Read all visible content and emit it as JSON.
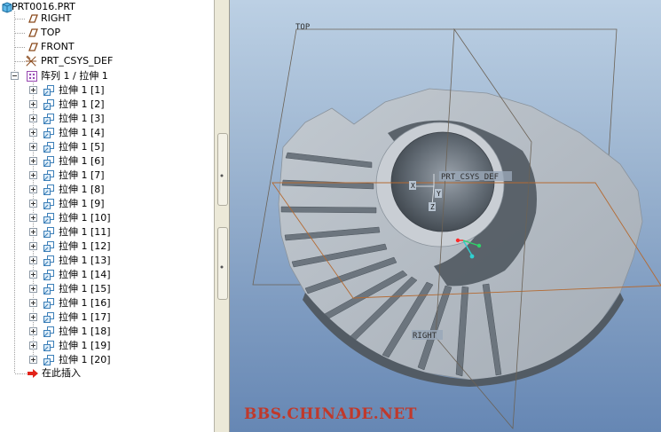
{
  "tree": {
    "root": "PRT0016.PRT",
    "datums": [
      {
        "label": "RIGHT",
        "icon": "datum-plane-icon"
      },
      {
        "label": "TOP",
        "icon": "datum-plane-icon"
      },
      {
        "label": "FRONT",
        "icon": "datum-plane-icon"
      },
      {
        "label": "PRT_CSYS_DEF",
        "icon": "coordinate-system-icon"
      }
    ],
    "pattern": "阵列 1 / 拉伸 1",
    "extrudes": [
      "拉伸 1 [1]",
      "拉伸 1 [2]",
      "拉伸 1 [3]",
      "拉伸 1 [4]",
      "拉伸 1 [5]",
      "拉伸 1 [6]",
      "拉伸 1 [7]",
      "拉伸 1 [8]",
      "拉伸 1 [9]",
      "拉伸 1 [10]",
      "拉伸 1 [11]",
      "拉伸 1 [12]",
      "拉伸 1 [13]",
      "拉伸 1 [14]",
      "拉伸 1 [15]",
      "拉伸 1 [16]",
      "拉伸 1 [17]",
      "拉伸 1 [18]",
      "拉伸 1 [19]",
      "拉伸 1 [20]"
    ],
    "insert_here": "在此插入"
  },
  "viewport": {
    "plane_labels": {
      "top": "TOP",
      "right": "RIGHT",
      "csys": "PRT_CSYS_DEF"
    },
    "axis_labels": {
      "x": "X",
      "y": "Y",
      "z": "Z"
    }
  },
  "watermark": "BBS.CHINADE.NET",
  "colors": {
    "model_gray": "#a9b1ba",
    "background_top": "#bcd0e4",
    "background_bottom": "#6687b4",
    "datum_orange": "#b46a32",
    "watermark": "#c0392b"
  }
}
